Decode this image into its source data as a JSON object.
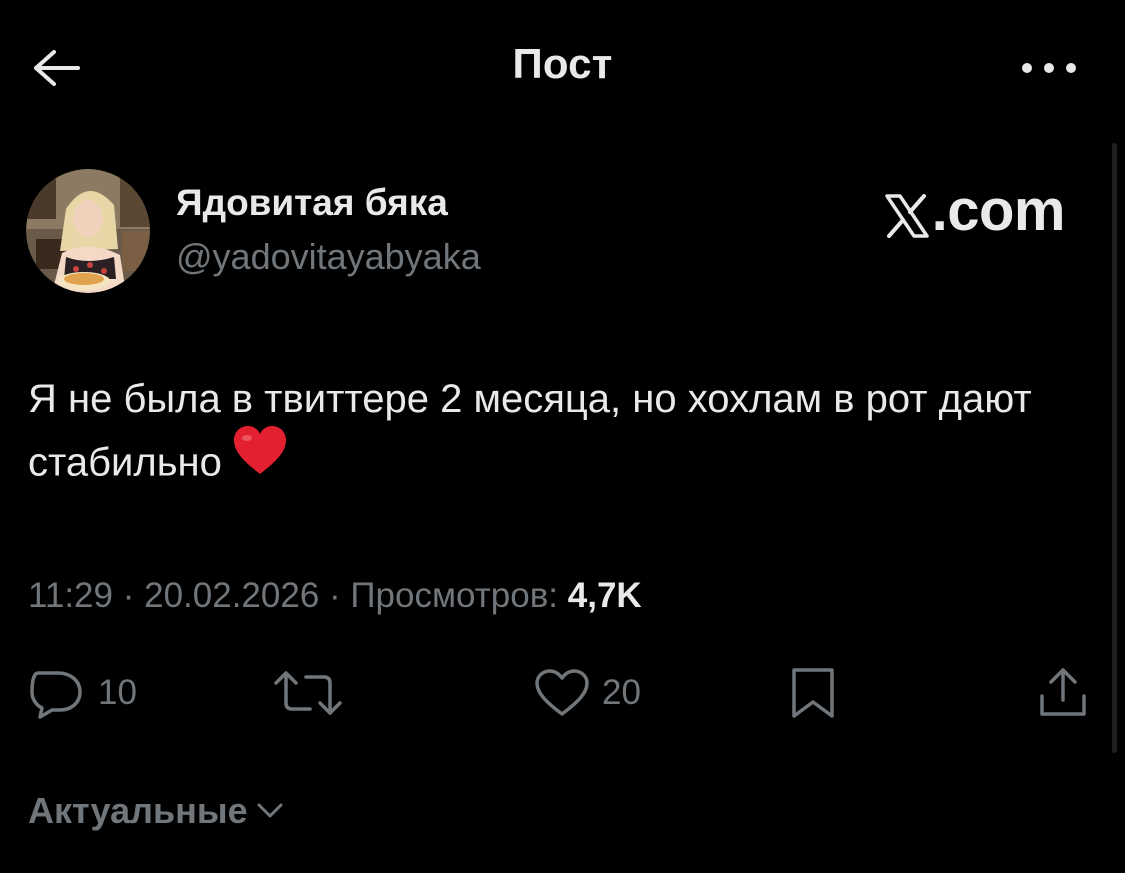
{
  "header": {
    "title": "Пост"
  },
  "author": {
    "name": "Ядовитая бяка",
    "handle": "@yadovitayabyaka"
  },
  "watermark": {
    "text": ".com"
  },
  "tweet": {
    "text": "Я не была в твиттере 2 месяца, но хохлам в рот дают стабильно"
  },
  "meta": {
    "time": "11:29",
    "separator1": " · ",
    "date": "20.02.2026",
    "separator2": " · ",
    "views_label": "Просмотров: ",
    "views_count": "4,7K"
  },
  "actions": {
    "reply_count": "10",
    "like_count": "20"
  },
  "replies_sort": {
    "label": "Актуальные"
  },
  "icons": {
    "back": "arrow-left-icon",
    "more": "more-dots-icon",
    "reply": "comment-icon",
    "retweet": "retweet-icon",
    "like": "heart-outline-icon",
    "bookmark": "bookmark-icon",
    "share": "share-icon",
    "emoji": "red-heart-emoji",
    "sort": "chevron-down-icon"
  },
  "colors": {
    "background": "#000000",
    "text_primary": "#e7e9ea",
    "text_secondary": "#71767b",
    "heart_emoji": "#e3202f"
  }
}
